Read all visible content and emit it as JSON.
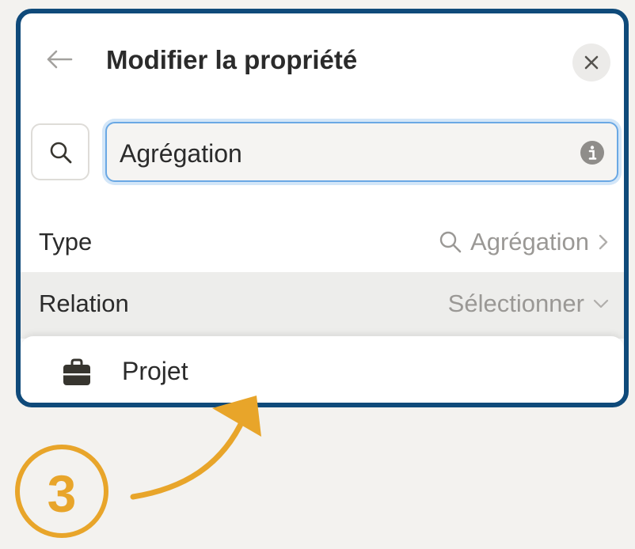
{
  "header": {
    "title": "Modifier la propriété",
    "back_icon": "arrow-left-icon",
    "close_icon": "close-icon"
  },
  "search": {
    "icon": "search-icon",
    "value": "Agrégation",
    "info_icon": "info-icon"
  },
  "properties": {
    "type": {
      "label": "Type",
      "value": "Agrégation",
      "value_icon": "search-icon",
      "chevron": "chevron-right-icon"
    },
    "relation": {
      "label": "Relation",
      "value": "Sélectionner",
      "chevron": "chevron-down-icon"
    }
  },
  "dropdown": {
    "items": [
      {
        "label": "Projet",
        "icon": "briefcase-icon"
      }
    ]
  },
  "annotation": {
    "step": "3",
    "color": "#e8a52a"
  },
  "colors": {
    "panel_border": "#0f4a7a",
    "focus_ring": "#6aa8e4",
    "background": "#f3f2ef"
  }
}
